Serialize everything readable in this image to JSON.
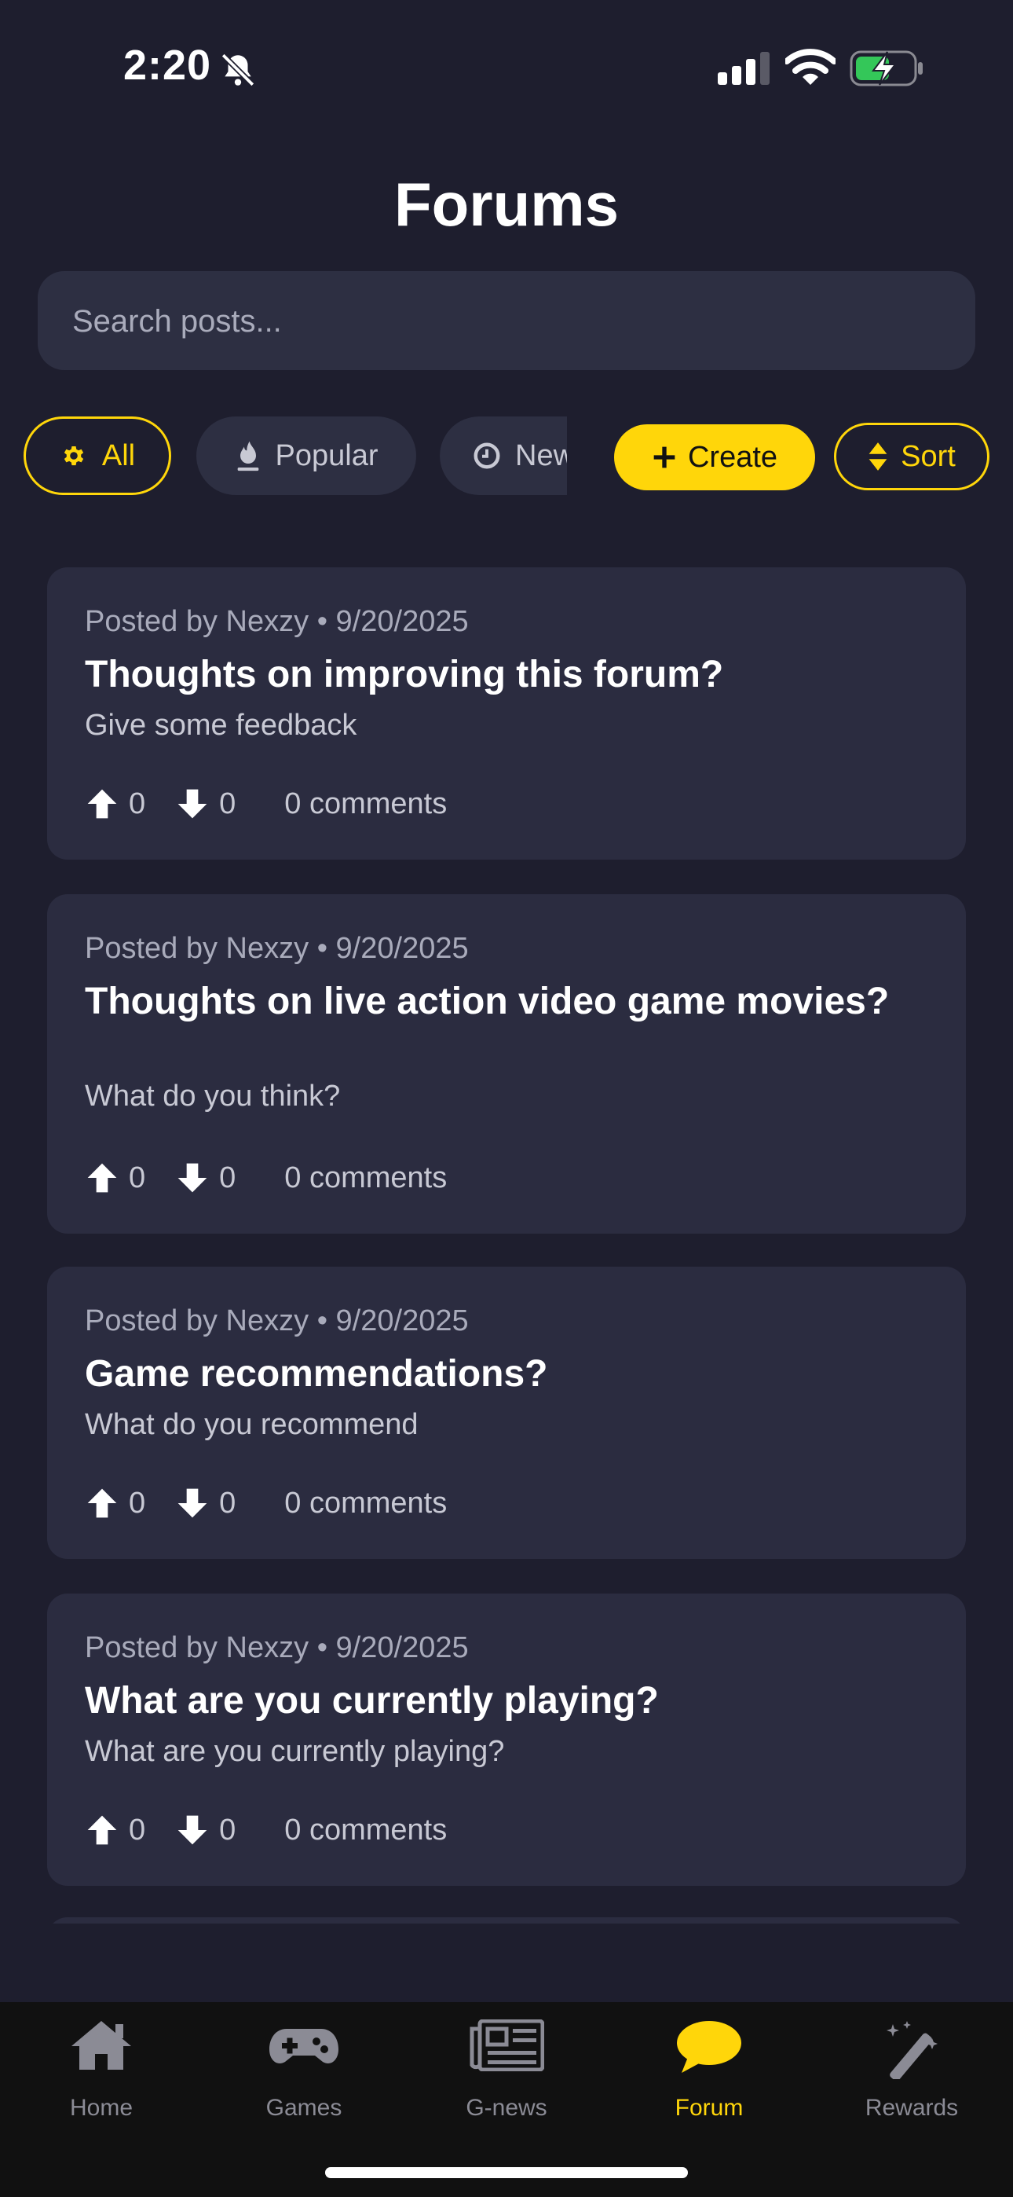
{
  "status_bar": {
    "time": "2:20"
  },
  "header": {
    "title": "Forums"
  },
  "search": {
    "placeholder": "Search posts..."
  },
  "filters": {
    "all": "All",
    "popular": "Popular",
    "new": "New",
    "create": "Create",
    "sort": "Sort",
    "active": "All"
  },
  "posts": [
    {
      "meta": "Posted by Nexzy • 9/20/2025",
      "title": "Thoughts on improving this forum?",
      "description": "Give some feedback",
      "upvotes": "0",
      "downvotes": "0",
      "comments": "0 comments"
    },
    {
      "meta": "Posted by Nexzy • 9/20/2025",
      "title": "Thoughts on live action video game movies?",
      "description": "What do you think?",
      "upvotes": "0",
      "downvotes": "0",
      "comments": "0 comments"
    },
    {
      "meta": "Posted by Nexzy • 9/20/2025",
      "title": "Game recommendations?",
      "description": "What do you recommend",
      "upvotes": "0",
      "downvotes": "0",
      "comments": "0 comments"
    },
    {
      "meta": "Posted by Nexzy • 9/20/2025",
      "title": "What are you currently playing?",
      "description": "What are you currently playing?",
      "upvotes": "0",
      "downvotes": "0",
      "comments": "0 comments"
    }
  ],
  "tabbar": {
    "home": "Home",
    "games": "Games",
    "gnews": "G-news",
    "forum": "Forum",
    "rewards": "Rewards",
    "active": "Forum"
  },
  "icons": {
    "status": [
      "bell-slash-icon",
      "cellular-signal-icon",
      "wifi-icon",
      "battery-charging-icon"
    ],
    "filters": [
      "gear-icon",
      "flame-icon",
      "clock-icon",
      "plus-icon",
      "sort-icon"
    ],
    "votes": [
      "arrow-up-icon",
      "arrow-down-icon"
    ],
    "tabs": [
      "home-icon",
      "gamepad-icon",
      "newspaper-icon",
      "chat-bubble-icon",
      "magic-wand-icon"
    ]
  },
  "colors": {
    "background": "#1e1e2e",
    "card": "#2b2c40",
    "accent": "#ffd60a",
    "tabbar": "#111111",
    "battery_charge": "#34c759"
  }
}
